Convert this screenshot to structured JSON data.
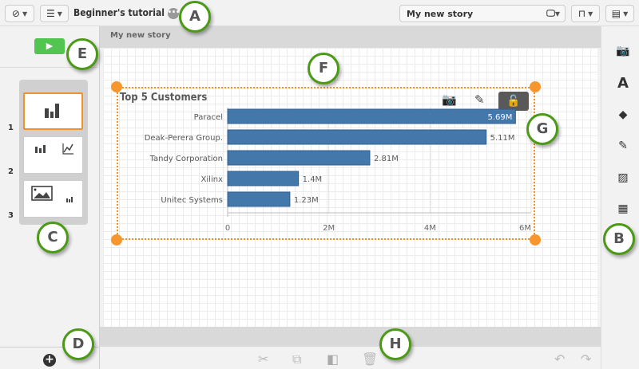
{
  "topbar": {
    "app_title": "Beginner's tutorial",
    "story_selector": "My new story",
    "icons": [
      "compass-icon",
      "list-icon",
      "more-icon",
      "presentation-icon",
      "bookmark-icon",
      "sheets-icon"
    ]
  },
  "left_panel": {
    "play_label": "▶",
    "slides": [
      {
        "number": "1",
        "content": [
          "bar-chart-icon"
        ]
      },
      {
        "number": "2",
        "content": [
          "bar-chart-icon",
          "line-chart-icon"
        ]
      },
      {
        "number": "3",
        "content": [
          "image-icon",
          "bar-chart-icon"
        ]
      }
    ],
    "add_label": "+"
  },
  "story": {
    "title": "My new story"
  },
  "right_panel": {
    "icons": [
      "snapshot-icon",
      "text-icon",
      "shapes-icon",
      "effects-icon",
      "media-icon",
      "sheet-icon"
    ]
  },
  "bottom_toolbar": {
    "icons": [
      "cut-icon",
      "copy-icon",
      "bring-forward-icon",
      "delete-icon",
      "undo-icon",
      "redo-icon"
    ]
  },
  "callouts": [
    "A",
    "B",
    "C",
    "D",
    "E",
    "F",
    "G",
    "H"
  ],
  "colors": {
    "bar": "#4477aa",
    "selection": "#f0922b",
    "callout_border": "#4b9a15",
    "play": "#52c450"
  },
  "chart_data": {
    "type": "bar",
    "orientation": "horizontal",
    "title": "Top 5 Customers",
    "categories": [
      "Paracel",
      "Deak-Perera Group.",
      "Tandy Corporation",
      "Xilinx",
      "Unitec Systems"
    ],
    "values": [
      5.69,
      5.11,
      2.81,
      1.4,
      1.23
    ],
    "labels": [
      "5.69M",
      "5.11M",
      "2.81M",
      "1.4M",
      "1.23M"
    ],
    "xlim": [
      0,
      6
    ],
    "ticks": [
      "0",
      "2M",
      "4M",
      "6M"
    ],
    "grid": true
  }
}
